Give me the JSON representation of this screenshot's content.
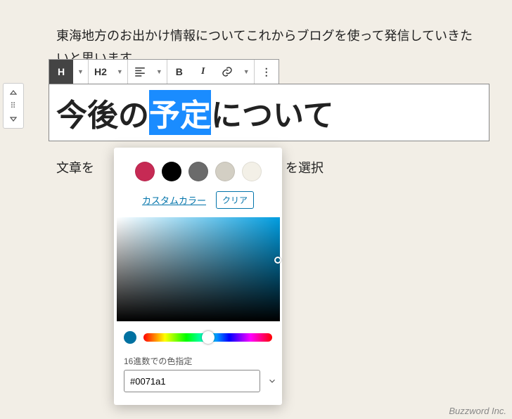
{
  "content": {
    "paragraph": "東海地方のお出かけ情報についてこれからブログを使って発信していきたいと思います。",
    "under_text_left": "文章を",
    "under_text_right": "を選択"
  },
  "toolbar": {
    "h": "H",
    "h2": "H2",
    "bold": "B",
    "italic": "I",
    "more": "⋮"
  },
  "heading": {
    "before": "今後の",
    "selected": "予定",
    "after": "について"
  },
  "color_picker": {
    "swatches": [
      "#c62a54",
      "#000000",
      "#6b6b6b",
      "#d3cfc4",
      "#f3f0e7"
    ],
    "custom_label": "カスタムカラー",
    "clear_label": "クリア",
    "hex_label": "16進数での色指定",
    "hex_value": "#0071a1",
    "preview_color": "#0071a1"
  },
  "footer": {
    "brand": "Buzzword Inc."
  }
}
